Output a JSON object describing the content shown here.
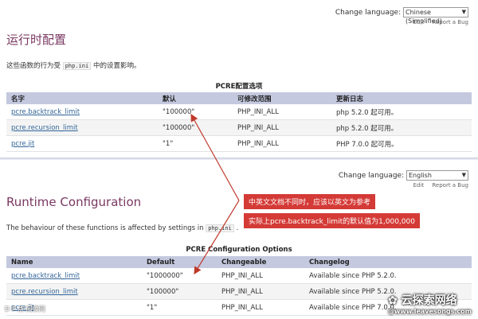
{
  "top": {
    "change_language_label": "Change language:",
    "selected_language": "Chinese (Simplified)",
    "edit": "Edit",
    "report_bug": "Report a Bug",
    "title": "运行时配置",
    "description_before": "这些函数的行为受",
    "description_code": "php.ini",
    "description_after": "中的设置影响。",
    "table_caption": "PCRE配置选项",
    "headers": [
      "名字",
      "默认",
      "可修改范围",
      "更新日志"
    ],
    "rows": [
      [
        "pcre.backtrack_limit",
        "\"100000\"",
        "PHP_INI_ALL",
        "php 5.2.0 起可用。"
      ],
      [
        "pcre.recursion_limit",
        "\"100000\"",
        "PHP_INI_ALL",
        "php 5.2.0 起可用。"
      ],
      [
        "pcre.jit",
        "\"1\"",
        "PHP_INI_ALL",
        "PHP 7.0.0 起可用。"
      ]
    ]
  },
  "bottom": {
    "change_language_label": "Change language:",
    "selected_language": "English",
    "edit": "Edit",
    "report_bug": "Report a Bug",
    "title": "Runtime Configuration",
    "description_before": "The behaviour of these functions is affected by settings in",
    "description_code": "php.ini",
    "description_after": ".",
    "table_caption": "PCRE Configuration Options",
    "headers": [
      "Name",
      "Default",
      "Changeable",
      "Changelog"
    ],
    "rows": [
      [
        "pcre.backtrack_limit",
        "\"1000000\"",
        "PHP_INI_ALL",
        "Available since PHP 5.2.0."
      ],
      [
        "pcre.recursion_limit",
        "\"100000\"",
        "PHP_INI_ALL",
        "Available since PHP 5.2.0."
      ],
      [
        "pcre.jit",
        "\"1\"",
        "PHP_INI_ALL",
        "Available since PHP 7.0.0."
      ]
    ]
  },
  "annotations": {
    "line1": "中英文文档不同时，应该以英文为参考",
    "line2": "实际上pcre.backtrack_limit的默认值为1,000,000",
    "color": "#d43a36"
  },
  "watermark": {
    "site_name": "云探索网络",
    "site_url": "@www.leavesongs.com",
    "left_text": "D P 点  阅读网"
  },
  "colors": {
    "title": "#793862",
    "table_header": "#c4c9df",
    "link": "#336699"
  }
}
